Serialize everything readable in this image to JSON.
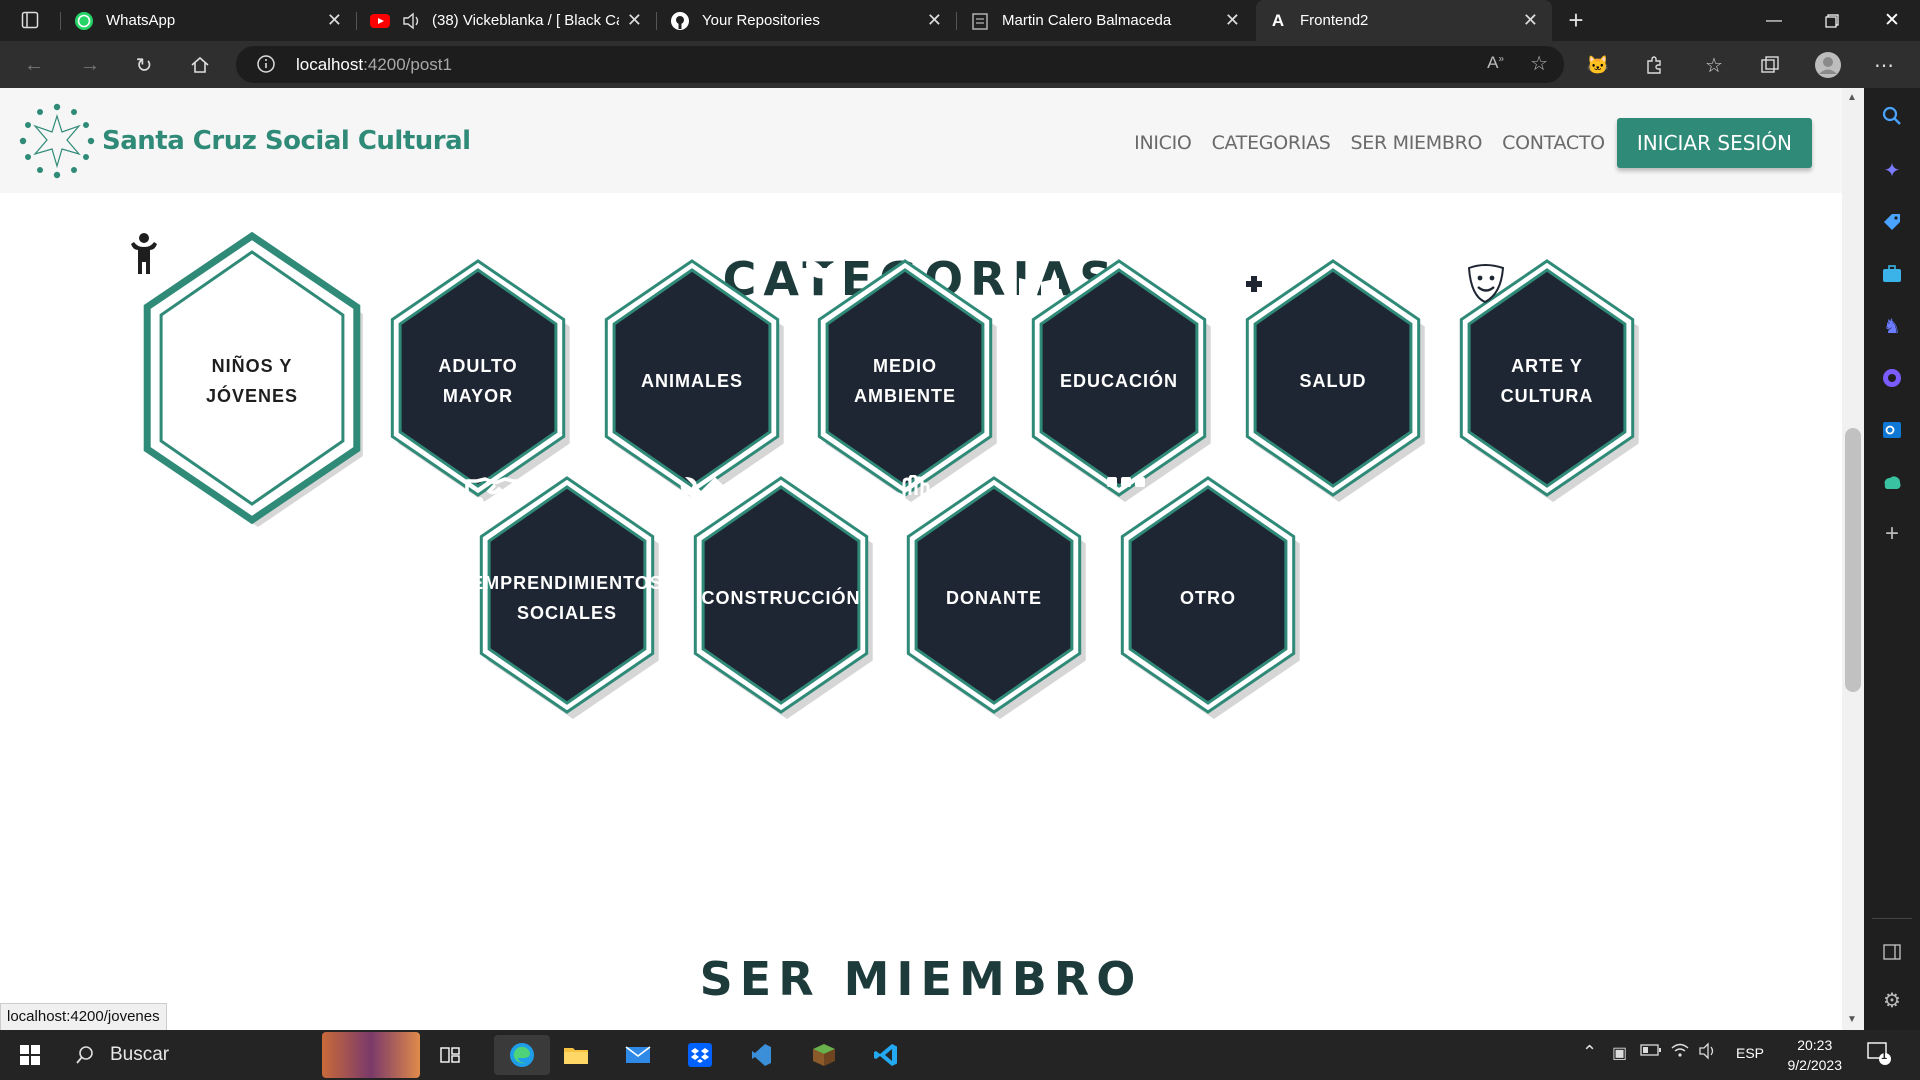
{
  "browser": {
    "tabs": [
      {
        "label": "WhatsApp",
        "icon": "whatsapp-icon",
        "active": false
      },
      {
        "label": "(38) Vickeblanka / [ Black Ca",
        "icon": "youtube-icon",
        "active": false
      },
      {
        "label": "Your Repositories",
        "icon": "github-icon",
        "active": false
      },
      {
        "label": "Martin Calero Balmaceda",
        "icon": "page-icon",
        "active": false
      },
      {
        "label": "Frontend2",
        "icon": "angular-icon",
        "active": true
      }
    ],
    "url_host": "localhost",
    "url_rest": ":4200/post1",
    "status_link": "localhost:4200/jovenes"
  },
  "site": {
    "brand": "Santa Cruz Social Cultural",
    "nav": [
      "INICIO",
      "CATEGORIAS",
      "SER MIEMBRO",
      "CONTACTO"
    ],
    "login": "INICIAR SESIÓN",
    "accent": "#2f8a78",
    "tile_dark": "#1f2633"
  },
  "categories": {
    "title": "CATEGORIAS",
    "items": [
      {
        "label1": "NIÑOS Y",
        "label2": "JÓVENES",
        "icon": "child-icon",
        "active": true
      },
      {
        "label1": "ADULTO",
        "label2": "MAYOR",
        "icon": "elder-walking-icon",
        "active": false
      },
      {
        "label1": "ANIMALES",
        "label2": "",
        "icon": "dog-icon",
        "active": false
      },
      {
        "label1": "MEDIO",
        "label2": "AMBIENTE",
        "icon": "seedling-icon",
        "active": false
      },
      {
        "label1": "EDUCACIÓN",
        "label2": "",
        "icon": "book-reader-icon",
        "active": false
      },
      {
        "label1": "SALUD",
        "label2": "",
        "icon": "clinic-icon",
        "active": false
      },
      {
        "label1": "ARTE Y",
        "label2": "CULTURA",
        "icon": "theater-masks-icon",
        "active": false
      },
      {
        "label1": "EMPRENDIMIENTOS",
        "label2": "SOCIALES",
        "icon": "handshake-icon",
        "active": false
      },
      {
        "label1": "CONSTRUCCIÓN",
        "label2": "",
        "icon": "tools-icon",
        "active": false
      },
      {
        "label1": "DONANTE",
        "label2": "",
        "icon": "hand-icon",
        "active": false
      },
      {
        "label1": "OTRO",
        "label2": "",
        "icon": "dots-icon",
        "active": false
      }
    ]
  },
  "member": {
    "title": "SER MIEMBRO"
  },
  "taskbar": {
    "search": "Buscar",
    "lang": "ESP",
    "time": "20:23",
    "date": "9/2/2023",
    "notifications": "1"
  }
}
